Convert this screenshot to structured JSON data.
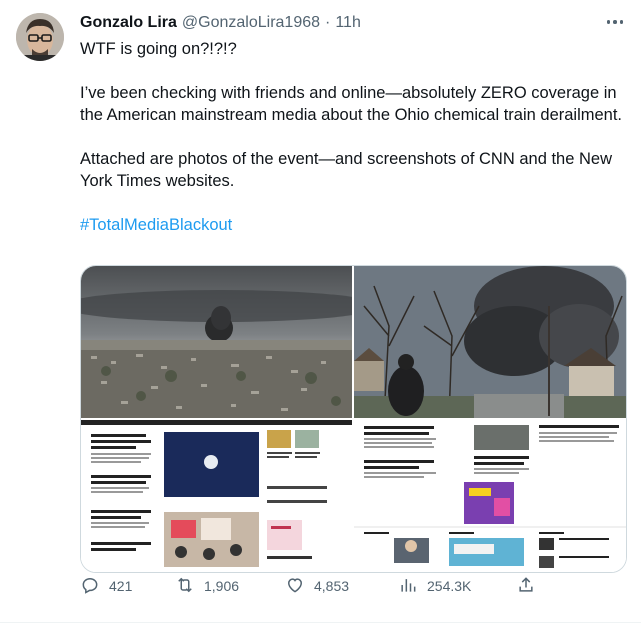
{
  "author": {
    "name": "Gonzalo Lira",
    "handle": "@GonzaloLira1968",
    "separator": "·",
    "time": "11h"
  },
  "tweet": {
    "line1": "WTF is going on?!?!?",
    "paragraph2": "I’ve been checking with friends and online—absolutely ZERO coverage in the American mainstream media about the Ohio chemical train derailment.",
    "paragraph3": "Attached are photos of the event—and screenshots of CNN and the New York Times websites.",
    "hashtag": "#TotalMediaBlackout"
  },
  "actions": {
    "replies": "421",
    "retweets": "1,906",
    "likes": "4,853",
    "views": "254.3K"
  },
  "icons": {
    "more": "more-horizontal-icon",
    "reply": "reply-icon",
    "retweet": "retweet-icon",
    "like": "heart-icon",
    "views": "views-icon",
    "share": "share-icon"
  },
  "colors": {
    "link": "#1d9bf0",
    "secondary_text": "#536471",
    "border": "#cfd9de"
  }
}
